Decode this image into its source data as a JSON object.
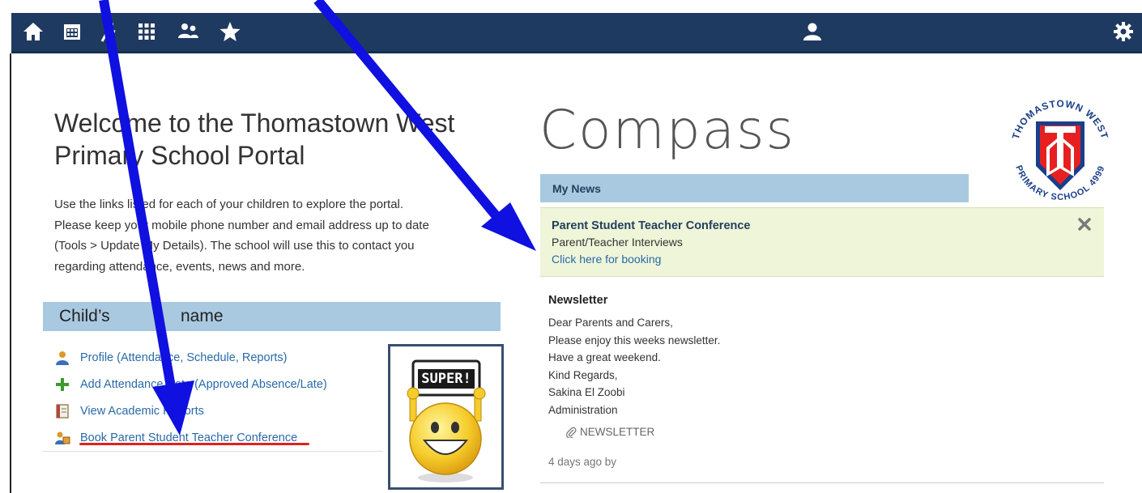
{
  "colors": {
    "navbar": "#1f3a60",
    "bar_blue": "#a9c9e0",
    "alert_bg": "#eef5d8",
    "link": "#2a6aa8",
    "arrow": "#1010e0",
    "underline": "#dd2222"
  },
  "navbar": {
    "left_icons": [
      "home-icon",
      "calendar-icon",
      "run-icon",
      "grid-icon",
      "people-icon",
      "star-icon"
    ],
    "center_icon": "user-icon",
    "right_icon": "gear-icon"
  },
  "welcome": {
    "title_line1": "Welcome to the Thomastown West",
    "title_line2": "Primary School Portal",
    "intro_line1": "Use the links listed for each of your children to explore the portal.",
    "intro_line2": "Please keep your mobile phone number and email address up to date",
    "intro_line3": "(Tools > Update My Details). The school will use this to contact you",
    "intro_line4": "regarding attendance, events, news and more."
  },
  "child": {
    "label": "Child’s",
    "name": "name"
  },
  "links": [
    {
      "label": "Profile (Attendance, Schedule, Reports)",
      "icon": "profile-icon"
    },
    {
      "label": "Add Attendance Note (Approved Absence/Late)",
      "icon": "plus-icon"
    },
    {
      "label": "View Academic Reports",
      "icon": "report-icon"
    },
    {
      "label": "Book Parent Student Teacher Conference",
      "icon": "conference-icon"
    }
  ],
  "sticker": {
    "text": "SUPER!"
  },
  "brand": {
    "name": "Compass"
  },
  "logo": {
    "text_top": "THOMASTOWN WEST",
    "text_bottom": "PRIMARY SCHOOL 4999"
  },
  "news": {
    "header": "My News",
    "alert": {
      "title": "Parent Student Teacher Conference",
      "subtitle": "Parent/Teacher Interviews",
      "link": "Click here for booking"
    },
    "newsletter": {
      "title": "Newsletter",
      "lines": [
        "Dear Parents and Carers,",
        "Please enjoy this weeks newsletter.",
        "Have a great weekend.",
        "Kind Regards,",
        "Sakina El Zoobi",
        "Administration"
      ],
      "attachment": "NEWSLETTER",
      "posted": "4 days ago by"
    }
  }
}
